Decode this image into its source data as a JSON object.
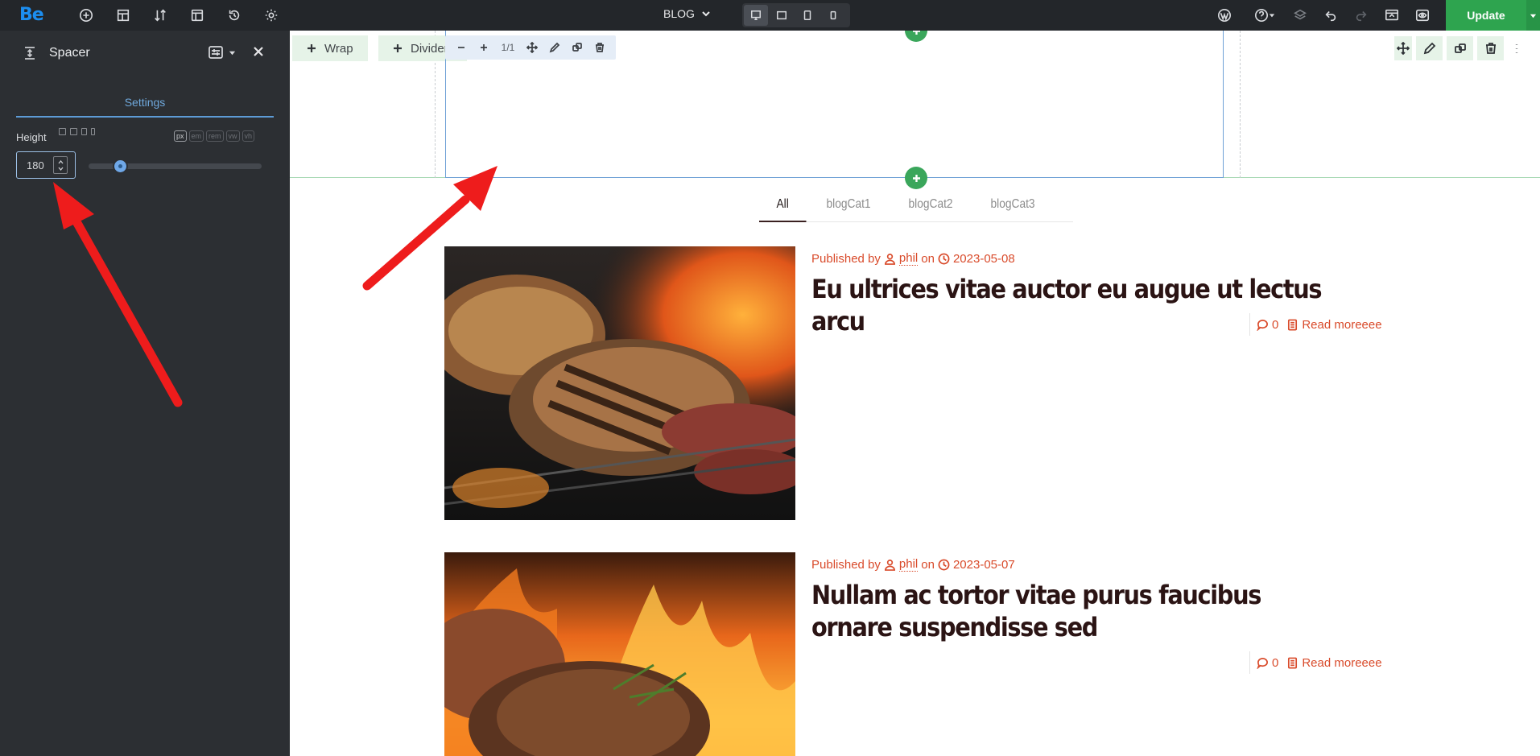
{
  "topbar": {
    "logo": "Be",
    "page_selector": "BLOG",
    "update_label": "Update",
    "accent_color": "#1c8ef0",
    "update_color": "#2ea44f"
  },
  "panel": {
    "title": "Spacer",
    "tab_settings": "Settings",
    "height_label": "Height",
    "height_value": "180",
    "slider_value": 180,
    "units": [
      "px",
      "em",
      "rem",
      "vw",
      "vh"
    ]
  },
  "canvas": {
    "add_wrap_label": "Wrap",
    "add_divider_label": "Divider",
    "ratio_label": "1/1",
    "filters": [
      "All",
      "blogCat1",
      "blogCat2",
      "blogCat3"
    ],
    "posts": [
      {
        "published_by": "Published by",
        "author": "phil",
        "on": "on",
        "date": "2023-05-08",
        "title": "Eu ultrices vitae auctor eu augue ut lectus arcu",
        "comments": "0",
        "read_more": "Read moreeee"
      },
      {
        "published_by": "Published by",
        "author": "phil",
        "on": "on",
        "date": "2023-05-07",
        "title": "Nullam ac tortor vitae purus faucibus ornare suspendisse sed",
        "comments": "0",
        "read_more": "Read moreeee"
      }
    ]
  }
}
